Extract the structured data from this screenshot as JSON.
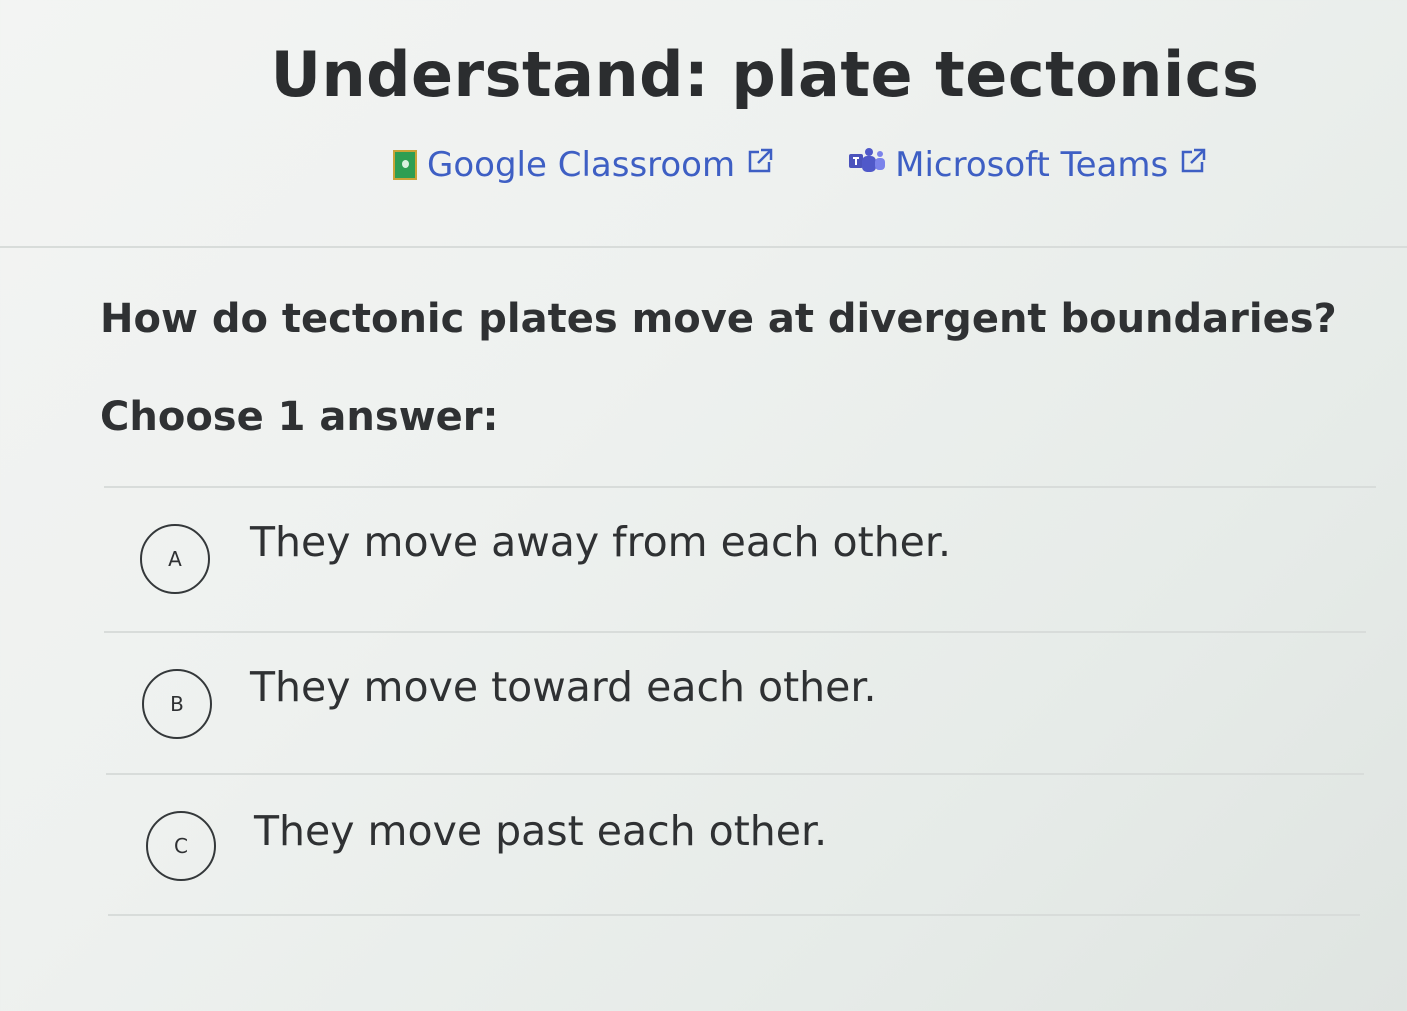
{
  "header": {
    "title": "Understand: plate tectonics",
    "share_links": [
      {
        "label": "Google Classroom",
        "icon": "google-classroom-icon"
      },
      {
        "label": "Microsoft Teams",
        "icon": "microsoft-teams-icon"
      }
    ],
    "link_color": "#3e5fc4"
  },
  "question": {
    "prompt": "How do tectonic plates move at divergent boundaries?",
    "instruction": "Choose 1 answer:",
    "choices": [
      {
        "letter": "A",
        "text": "They move away from each other."
      },
      {
        "letter": "B",
        "text": "They move toward each other."
      },
      {
        "letter": "C",
        "text": "They move past each other."
      }
    ]
  }
}
